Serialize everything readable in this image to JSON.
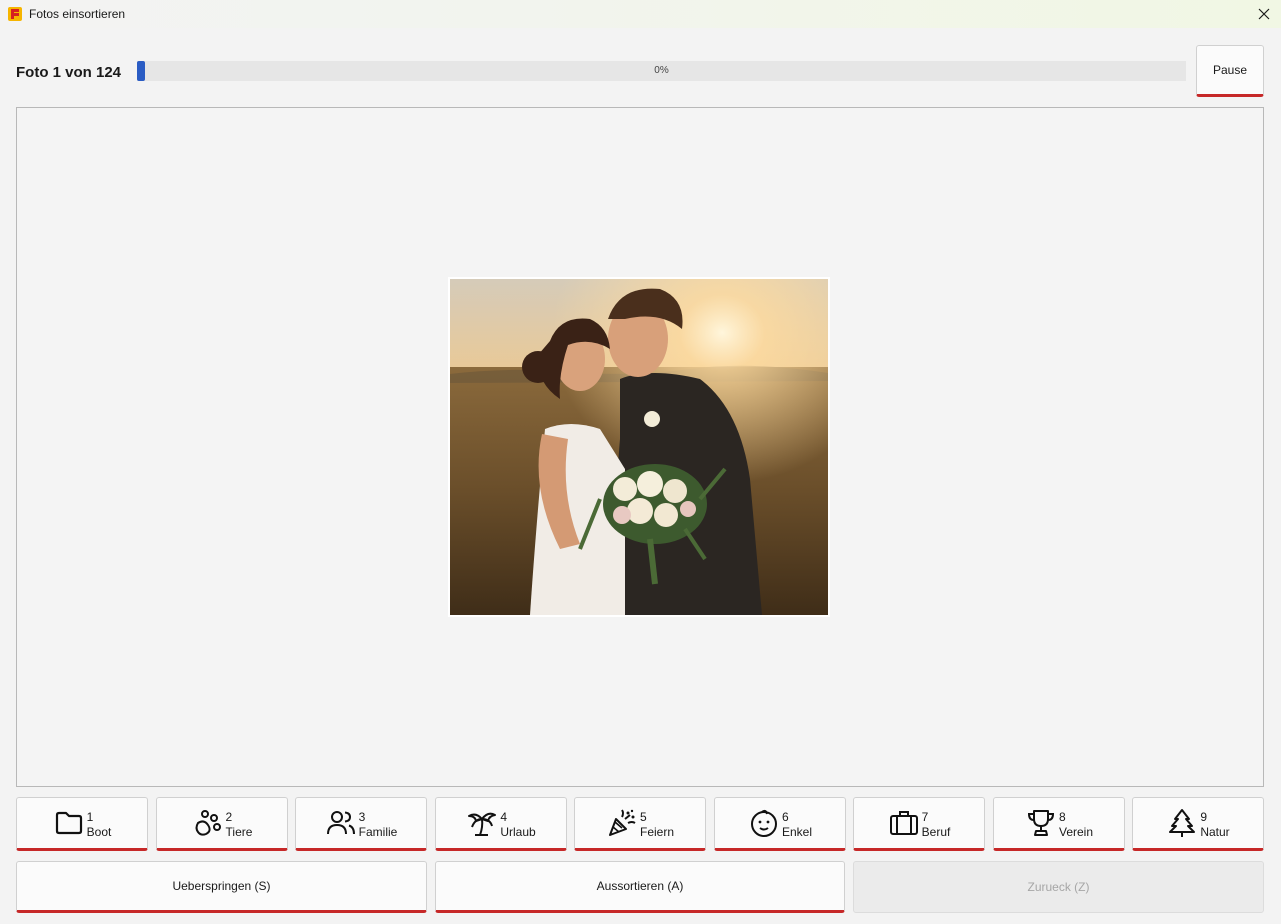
{
  "window": {
    "title": "Fotos einsortieren",
    "app_icon": "app-logo-icon",
    "close_icon": "close-icon"
  },
  "progress": {
    "label": "Foto 1 von 124",
    "percent_text": "0%",
    "fraction": 0.0,
    "fill_color": "#2a5cc4"
  },
  "pause_button": {
    "label": "Pause"
  },
  "photo": {
    "subject": "wedding-couple-photo"
  },
  "categories": [
    {
      "number": "1",
      "label": "Boot",
      "icon": "folder-icon"
    },
    {
      "number": "2",
      "label": "Tiere",
      "icon": "paw-icon"
    },
    {
      "number": "3",
      "label": "Familie",
      "icon": "users-icon"
    },
    {
      "number": "4",
      "label": "Urlaub",
      "icon": "palm-tree-icon"
    },
    {
      "number": "5",
      "label": "Feiern",
      "icon": "party-popper-icon"
    },
    {
      "number": "6",
      "label": "Enkel",
      "icon": "baby-face-icon"
    },
    {
      "number": "7",
      "label": "Beruf",
      "icon": "briefcase-icon"
    },
    {
      "number": "8",
      "label": "Verein",
      "icon": "trophy-icon"
    },
    {
      "number": "9",
      "label": "Natur",
      "icon": "tree-icon"
    }
  ],
  "actions": {
    "skip": "Ueberspringen (S)",
    "discard": "Aussortieren (A)",
    "back": "Zurueck (Z)"
  },
  "colors": {
    "accent_underline": "#c62828",
    "progress": "#2a5cc4",
    "background": "#f3f3f3"
  }
}
